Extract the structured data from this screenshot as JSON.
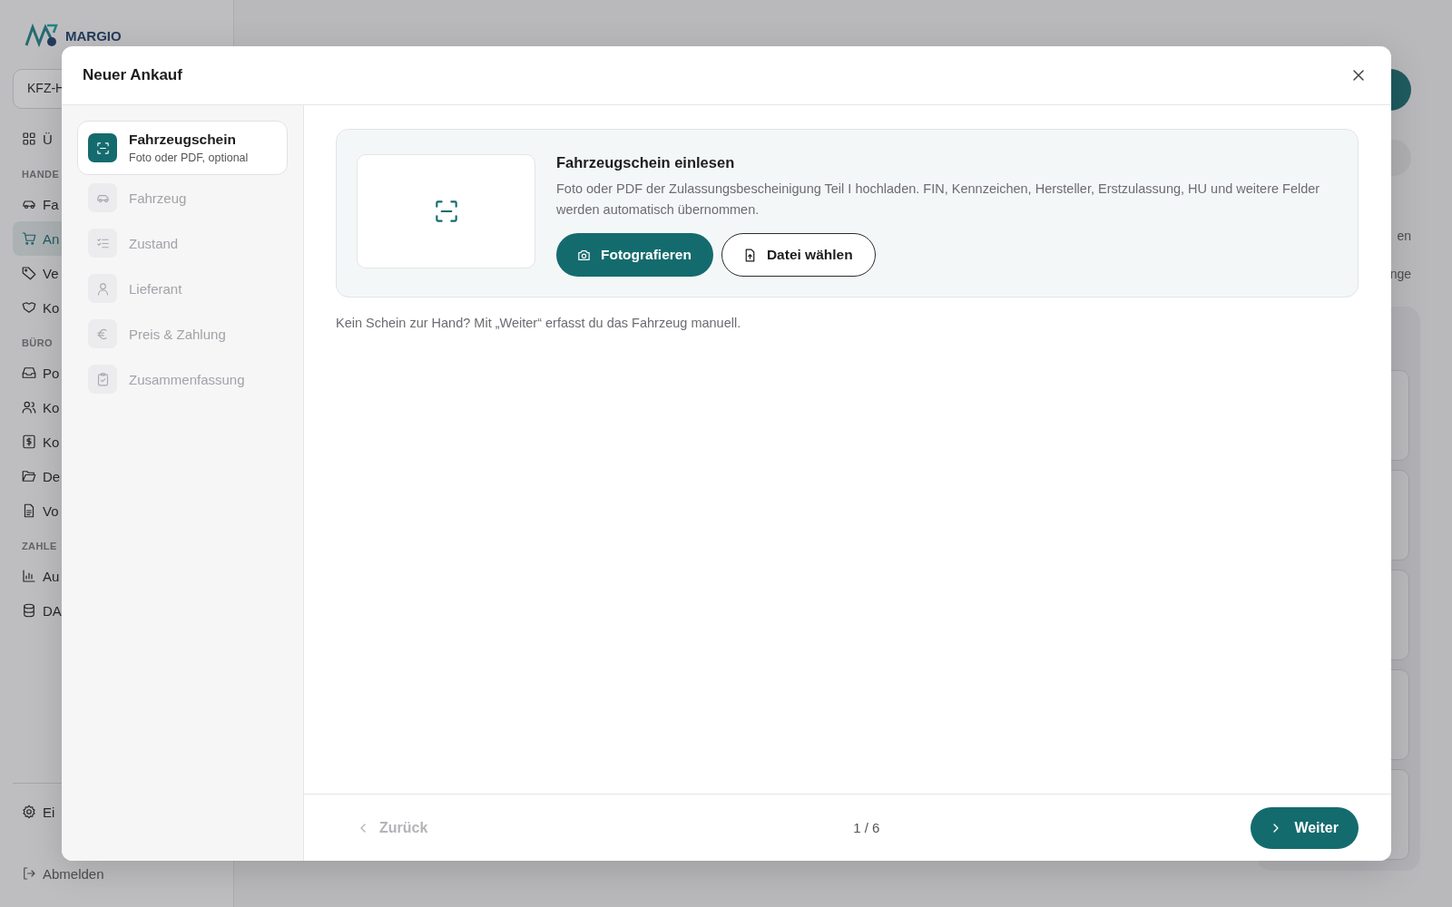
{
  "background": {
    "brand": "MARGIO",
    "company_select": "KFZ-H",
    "nav": [
      {
        "kind": "item",
        "label": "Ü",
        "selected": false
      },
      {
        "kind": "section",
        "label": "HANDE"
      },
      {
        "kind": "item",
        "label": "Fa",
        "selected": false
      },
      {
        "kind": "item",
        "label": "An",
        "selected": true
      },
      {
        "kind": "item",
        "label": "Ve",
        "selected": false
      },
      {
        "kind": "item",
        "label": "Ko",
        "selected": false
      },
      {
        "kind": "section",
        "label": "BÜRO"
      },
      {
        "kind": "item",
        "label": "Po",
        "selected": false
      },
      {
        "kind": "item",
        "label": "Ko",
        "selected": false
      },
      {
        "kind": "item",
        "label": "Ko",
        "selected": false
      },
      {
        "kind": "item",
        "label": "De",
        "selected": false
      },
      {
        "kind": "item",
        "label": "Vo",
        "selected": false
      },
      {
        "kind": "section",
        "label": "ZAHLE"
      },
      {
        "kind": "item",
        "label": "Au",
        "selected": false
      },
      {
        "kind": "item",
        "label": "DA",
        "selected": false
      }
    ],
    "settings": "Ei",
    "logout": "Abmelden",
    "right_texts": [
      "en",
      "nge"
    ]
  },
  "dialog": {
    "title": "Neuer Ankauf",
    "steps": [
      {
        "label": "Fahrzeugschein",
        "subtitle": "Foto oder PDF, optional",
        "selected": true
      },
      {
        "label": "Fahrzeug",
        "selected": false
      },
      {
        "label": "Zustand",
        "selected": false
      },
      {
        "label": "Lieferant",
        "selected": false
      },
      {
        "label": "Preis & Zahlung",
        "selected": false
      },
      {
        "label": "Zusammenfassung",
        "selected": false
      }
    ],
    "upload": {
      "title": "Fahrzeugschein einlesen",
      "description": "Foto oder PDF der Zulassungsbescheinigung Teil I hochladen. FIN, Kennzeichen, Hersteller, Erstzulassung, HU und weitere Felder werden automatisch übernommen.",
      "buttons": [
        {
          "kind": "primary",
          "label": "Fotografieren"
        },
        {
          "kind": "outline",
          "label": "Datei wählen"
        }
      ]
    },
    "hint": "Kein Schein zur Hand? Mit „Weiter“ erfasst du das Fahrzeug manuell.",
    "footer": {
      "back": "Zurück",
      "back_disabled": true,
      "progress": "1 / 6",
      "next": "Weiter"
    }
  }
}
